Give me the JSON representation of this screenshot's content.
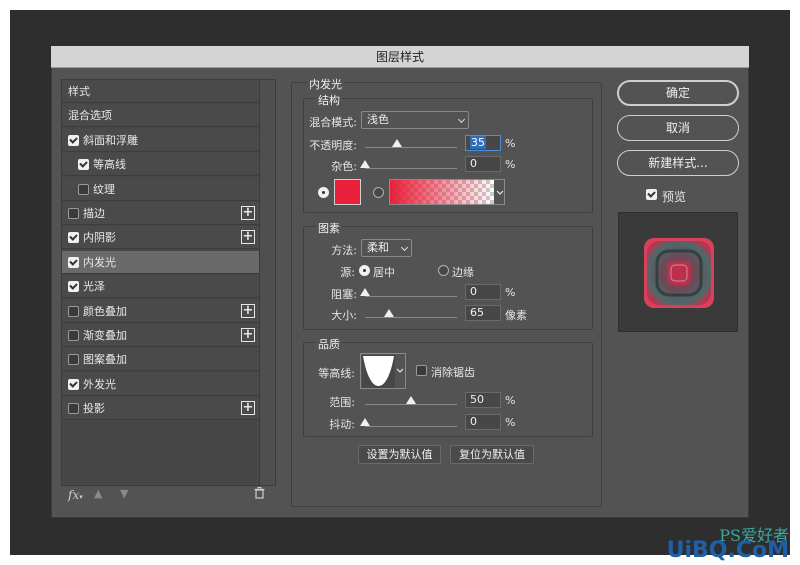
{
  "dialog": {
    "title": "图层样式"
  },
  "style_list": {
    "items": [
      {
        "label": "样式",
        "checkbox": null,
        "checked": false,
        "plus": false,
        "selected": false
      },
      {
        "label": "混合选项",
        "checkbox": null,
        "checked": false,
        "plus": false,
        "selected": false
      },
      {
        "label": "斜面和浮雕",
        "checkbox": true,
        "checked": true,
        "plus": false,
        "selected": false
      },
      {
        "label": "等高线",
        "checkbox": true,
        "checked": true,
        "plus": false,
        "selected": false,
        "indent": true
      },
      {
        "label": "纹理",
        "checkbox": true,
        "checked": false,
        "plus": false,
        "selected": false,
        "indent": true
      },
      {
        "label": "描边",
        "checkbox": true,
        "checked": false,
        "plus": true,
        "selected": false
      },
      {
        "label": "内阴影",
        "checkbox": true,
        "checked": true,
        "plus": true,
        "selected": false
      },
      {
        "label": "内发光",
        "checkbox": true,
        "checked": true,
        "plus": false,
        "selected": true
      },
      {
        "label": "光泽",
        "checkbox": true,
        "checked": true,
        "plus": false,
        "selected": false
      },
      {
        "label": "颜色叠加",
        "checkbox": true,
        "checked": false,
        "plus": true,
        "selected": false
      },
      {
        "label": "渐变叠加",
        "checkbox": true,
        "checked": false,
        "plus": true,
        "selected": false
      },
      {
        "label": "图案叠加",
        "checkbox": true,
        "checked": false,
        "plus": false,
        "selected": false
      },
      {
        "label": "外发光",
        "checkbox": true,
        "checked": true,
        "plus": false,
        "selected": false
      },
      {
        "label": "投影",
        "checkbox": true,
        "checked": false,
        "plus": true,
        "selected": false
      }
    ],
    "fx_label": "fx"
  },
  "inner_glow": {
    "title": "内发光",
    "structure": {
      "title": "结构",
      "blend_mode_label": "混合模式:",
      "blend_mode_value": "浅色",
      "opacity_label": "不透明度:",
      "opacity_value": "35",
      "opacity_unit": "%",
      "opacity_fraction": 0.35,
      "noise_label": "杂色:",
      "noise_value": "0",
      "noise_unit": "%",
      "noise_fraction": 0,
      "color": "#e8203a"
    },
    "elements": {
      "title": "图素",
      "technique_label": "方法:",
      "technique_value": "柔和",
      "source_label": "源:",
      "source_center": "居中",
      "source_edge": "边缘",
      "choke_label": "阻塞:",
      "choke_value": "0",
      "choke_unit": "%",
      "choke_fraction": 0,
      "size_label": "大小:",
      "size_value": "65",
      "size_unit": "像素",
      "size_fraction": 0.26
    },
    "quality": {
      "title": "品质",
      "contour_label": "等高线:",
      "antialias_label": "消除锯齿",
      "range_label": "范围:",
      "range_value": "50",
      "range_unit": "%",
      "range_fraction": 0.5,
      "jitter_label": "抖动:",
      "jitter_value": "0",
      "jitter_unit": "%",
      "jitter_fraction": 0
    },
    "make_default": "设置为默认值",
    "reset_default": "复位为默认值"
  },
  "buttons": {
    "ok": "确定",
    "cancel": "取消",
    "new_style": "新建样式...",
    "preview_label": "预览"
  },
  "watermark": {
    "line1": "PS爱好者",
    "line2": "UiBQ.CoM"
  }
}
